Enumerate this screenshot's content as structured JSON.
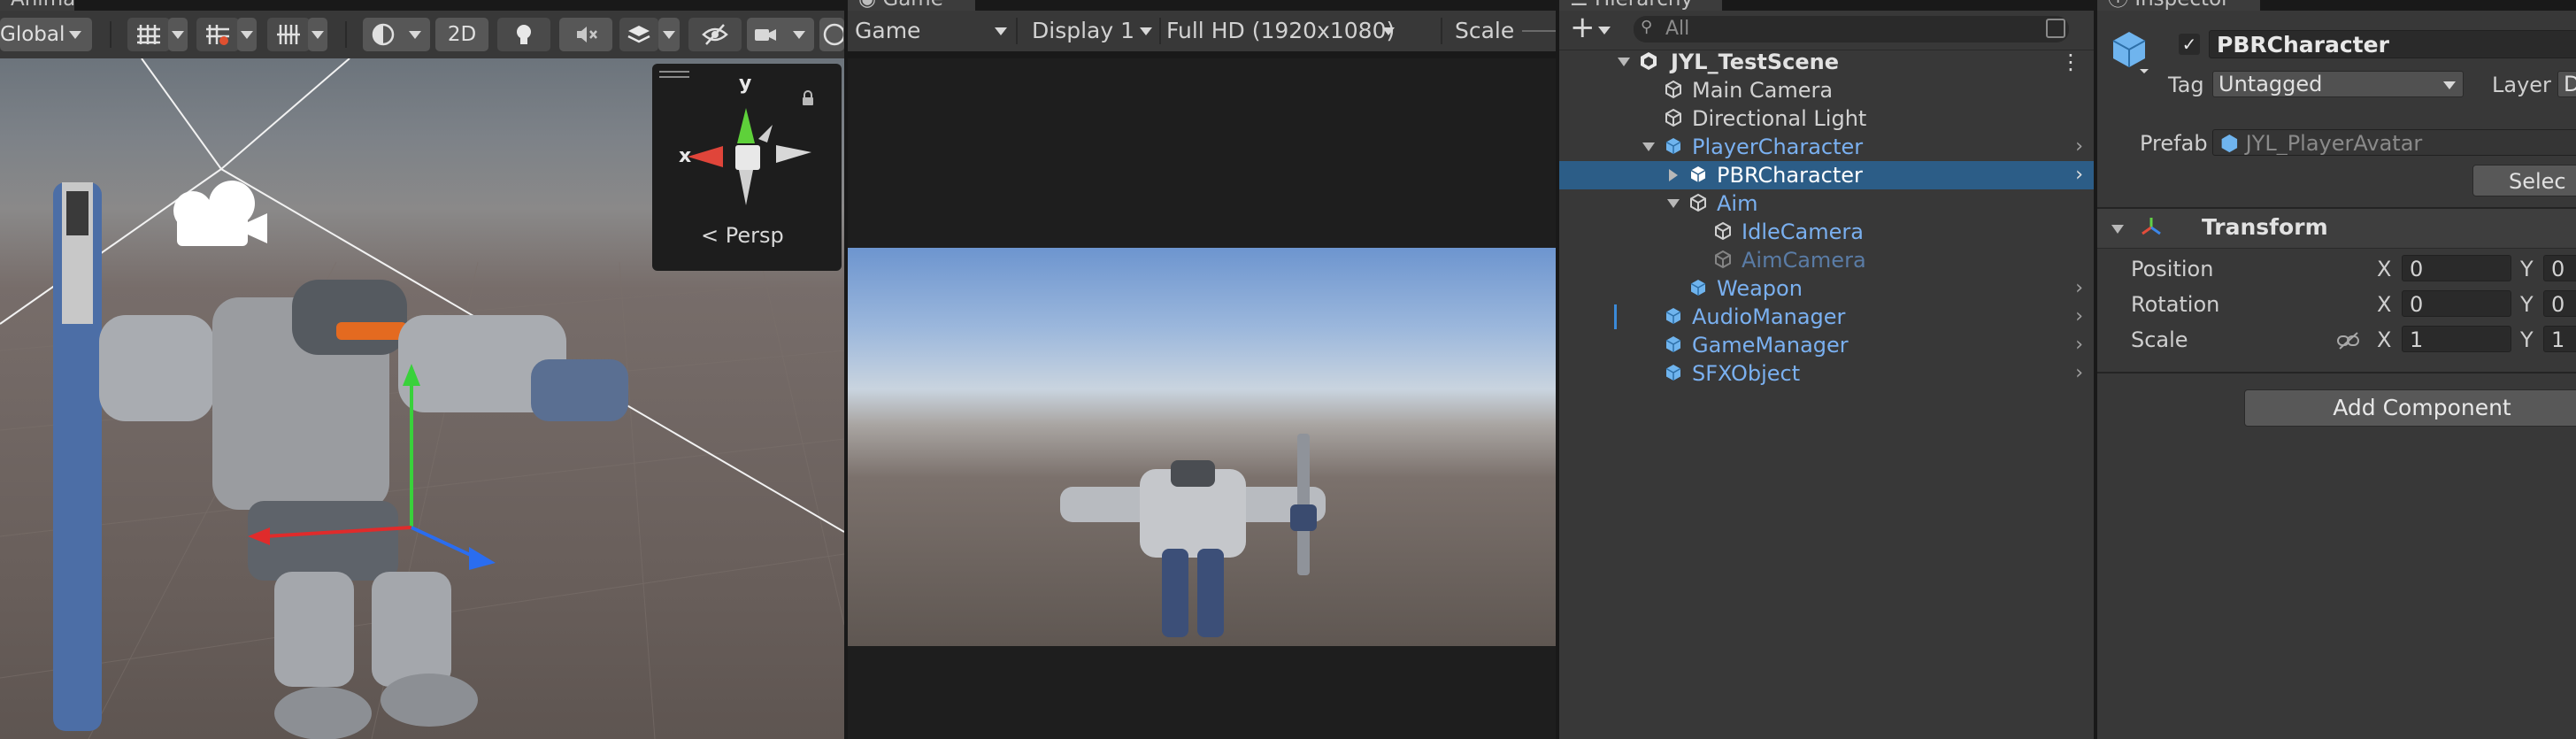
{
  "scene_view": {
    "tab_label": "Animator",
    "toolbar": {
      "global_dropdown": "Global",
      "btn_2d": "2D"
    },
    "gizmo": {
      "axis_y": "y",
      "axis_x": "x",
      "projection": "Persp"
    }
  },
  "game_view": {
    "tab_label": "Game",
    "display_mode": "Game",
    "display": "Display 1",
    "resolution": "Full HD (1920x1080)",
    "scale_label": "Scale"
  },
  "hierarchy": {
    "tab_label": "Hierarchy",
    "search_placeholder": "All",
    "scene_name": "JYL_TestScene",
    "items": [
      {
        "label": "Main Camera",
        "color": "#d2d2d2"
      },
      {
        "label": "Directional Light",
        "color": "#d2d2d2"
      },
      {
        "label": "PlayerCharacter",
        "color": "#7ab0f0"
      },
      {
        "label": "PBRCharacter",
        "color": "#ffffff"
      },
      {
        "label": "Aim",
        "color": "#7ab0f0"
      },
      {
        "label": "IdleCamera",
        "color": "#7ab0f0"
      },
      {
        "label": "AimCamera",
        "color": "#5a7ca6"
      },
      {
        "label": "Weapon",
        "color": "#7ab0f0"
      },
      {
        "label": "AudioManager",
        "color": "#7ab0f0"
      },
      {
        "label": "GameManager",
        "color": "#7ab0f0"
      },
      {
        "label": "SFXObject",
        "color": "#7ab0f0"
      }
    ]
  },
  "inspector": {
    "tab_label": "Inspector",
    "object_name": "PBRCharacter",
    "tag_label": "Tag",
    "tag_value": "Untagged",
    "layer_label": "Layer",
    "layer_value": "D",
    "prefab_label": "Prefab",
    "prefab_value": "JYL_PlayerAvatar",
    "select_button": "Selec",
    "transform": {
      "title": "Transform",
      "position_label": "Position",
      "rotation_label": "Rotation",
      "scale_label": "Scale",
      "x_label": "X",
      "y_label": "Y",
      "position": {
        "x": "0",
        "y": "0"
      },
      "rotation": {
        "x": "0",
        "y": "0"
      },
      "scale": {
        "x": "1",
        "y": "1"
      }
    },
    "add_component": "Add Component"
  },
  "colors": {
    "selection": "#2c5d87",
    "prefab_blue": "#7ab0f0",
    "panel_bg": "#383838"
  }
}
